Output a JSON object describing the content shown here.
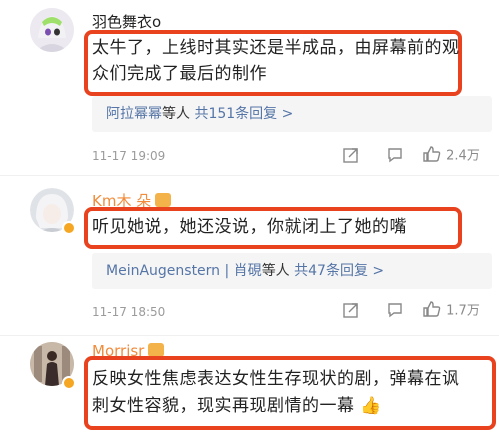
{
  "comments": [
    {
      "username": "羽色舞衣o",
      "text_line1": "太牛了，上线时其实还是半成品，由屏幕前的观",
      "text_line2": "众们完成了最后的制作",
      "reply_names": "阿拉幂幂",
      "reply_mid": "等人",
      "reply_count": "共151条回复 >",
      "time": "11-17 19:09",
      "likes": "2.4万"
    },
    {
      "username": "Km木 朵",
      "text_line1": "听见她说，她还没说，你就闭上了她的嘴",
      "reply_names": "MeinAugenstern | 肖硯",
      "reply_mid": "等人",
      "reply_count": "共47条回复 >",
      "time": "11-17 18:50",
      "likes": "1.7万"
    },
    {
      "username": "Morrisr",
      "text_line1": "反映女性焦虑表达女性生存现状的剧，弹幕在讽",
      "text_line2": "刺女性容貌，现实再现剧情的一幕",
      "emoji": "👍"
    }
  ],
  "colors": {
    "accent_red": "#e8421e",
    "link_blue": "#5575a6",
    "muted_gray": "#9b9b9b",
    "username_orange": "#f08c3c"
  }
}
